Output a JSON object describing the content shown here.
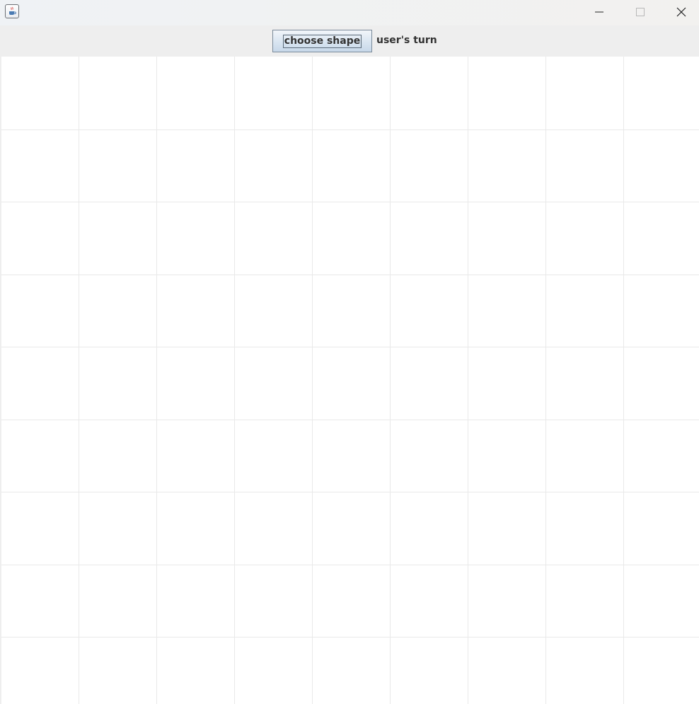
{
  "window": {
    "app_icon": "java-cup-icon",
    "controls": {
      "minimize_icon": "minimize-icon",
      "maximize_icon": "maximize-icon",
      "close_icon": "close-icon"
    }
  },
  "toolbar": {
    "choose_shape_label": "choose shape",
    "turn_status": "user's turn"
  },
  "board": {
    "columns": 9,
    "rows": 9
  },
  "colors": {
    "toolbar_bg": "#eeeeee",
    "grid_line": "#e9e9e9",
    "button_border": "#7a8a99",
    "text": "#333333"
  }
}
